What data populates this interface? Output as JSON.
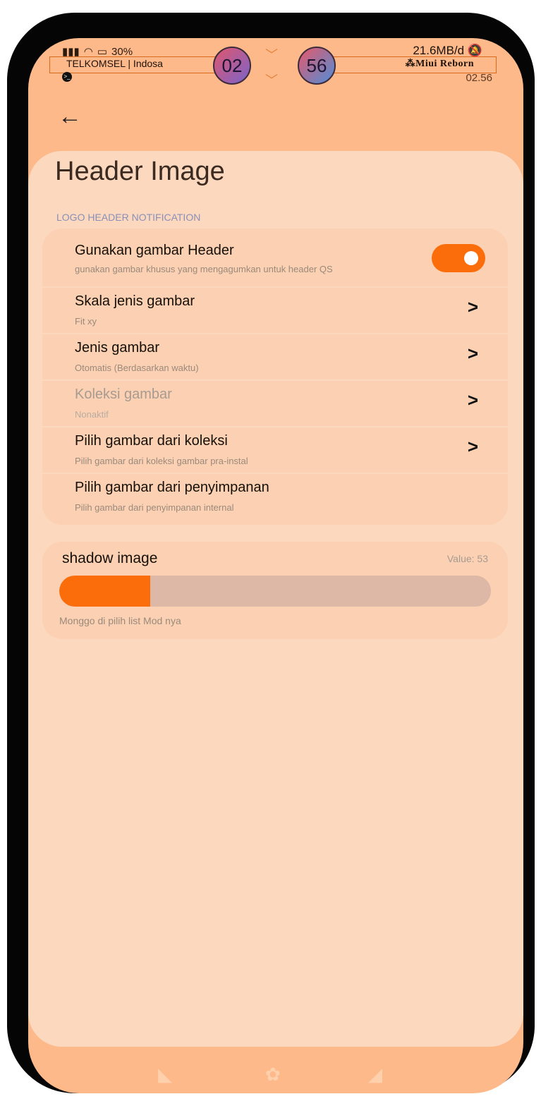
{
  "status_bar": {
    "battery": "30%",
    "carrier": "TELKOMSEL | Indosa",
    "hour": "02",
    "minute": "56",
    "data_usage": "21.6MB/d",
    "brand": "⁂Miui Reborn",
    "time": "02.56"
  },
  "header": {
    "back_icon": "←",
    "title": "Header Image",
    "section_label": "LOGO HEADER NOTIFICATION"
  },
  "settings": [
    {
      "title": "Gunakan gambar Header",
      "subtitle": "gunakan gambar khusus yang mengagumkan untuk header QS",
      "control": "toggle",
      "enabled": true
    },
    {
      "title": "Skala jenis gambar",
      "subtitle": "Fit xy",
      "control": "chevron"
    },
    {
      "title": "Jenis gambar",
      "subtitle": "Otomatis (Berdasarkan waktu)",
      "control": "chevron"
    },
    {
      "title": "Koleksi gambar",
      "subtitle": "Nonaktif",
      "control": "chevron",
      "disabled": true
    },
    {
      "title": "Pilih gambar dari koleksi",
      "subtitle": "Pilih gambar dari koleksi gambar pra-instal",
      "control": "chevron"
    },
    {
      "title": "Pilih gambar dari penyimpanan",
      "subtitle": "Pilih gambar dari penyimpanan internal",
      "control": "none"
    }
  ],
  "slider": {
    "title": "shadow image",
    "value_label": "Value: 53",
    "value": 53,
    "fill_fraction": 0.21,
    "hint": "Monggo di pilih list Mod nya"
  },
  "colors": {
    "accent": "#fb6d0b",
    "background": "#fdb98a",
    "card": "#fcd8bf"
  }
}
